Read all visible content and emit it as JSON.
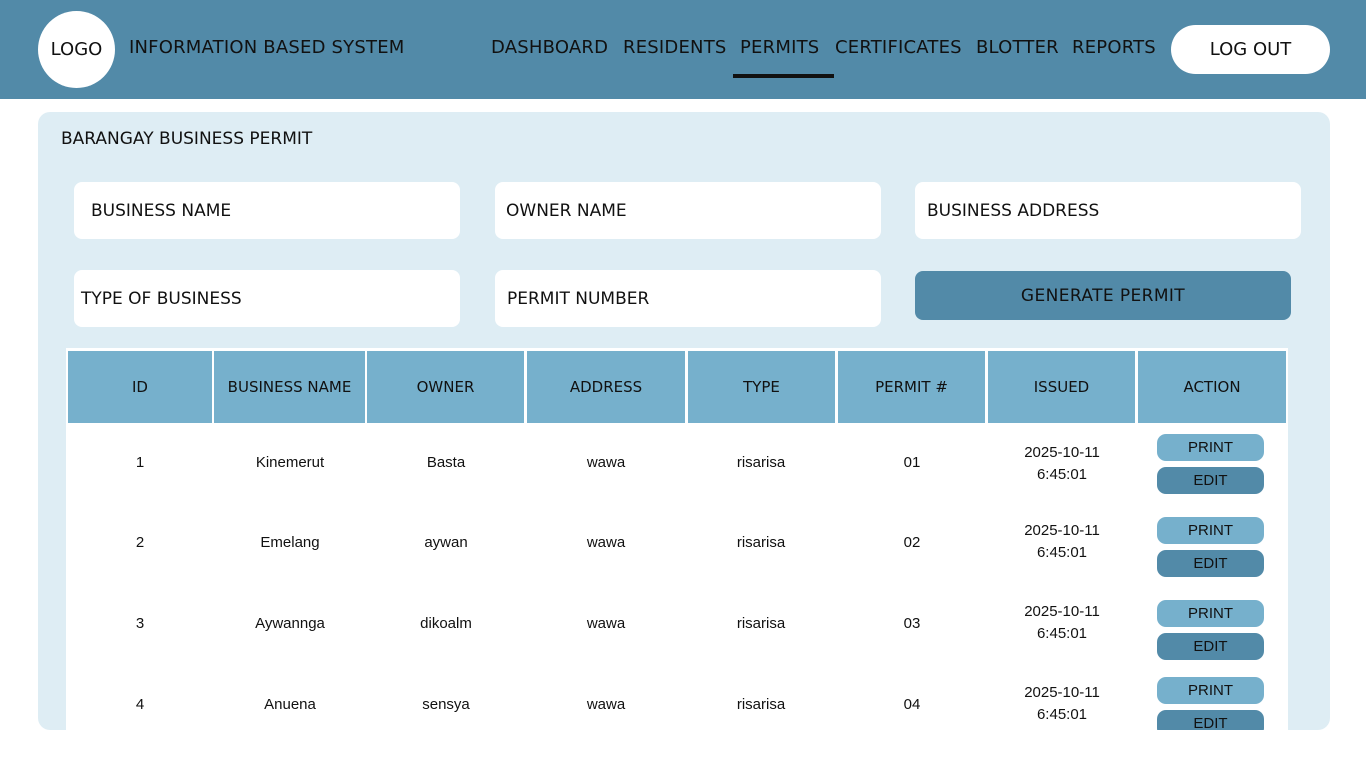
{
  "header": {
    "logo": "LOGO",
    "title": "INFORMATION BASED SYSTEM",
    "nav": [
      "DASHBOARD",
      "RESIDENTS",
      "PERMITS",
      "CERTIFICATES",
      "BLOTTER",
      "REPORTS"
    ],
    "active_nav": "PERMITS",
    "logout": "LOG OUT"
  },
  "panel": {
    "title": "BARANGAY BUSINESS PERMIT",
    "fields": {
      "business_name": "BUSINESS NAME",
      "owner_name": "OWNER NAME",
      "business_address": "BUSINESS ADDRESS",
      "type_of_business": "TYPE OF BUSINESS",
      "permit_number": "PERMIT NUMBER"
    },
    "generate_button": "GENERATE  PERMIT"
  },
  "table": {
    "columns": [
      "ID",
      "BUSINESS NAME",
      "OWNER",
      "ADDRESS",
      "TYPE",
      "PERMIT #",
      "ISSUED",
      "ACTION"
    ],
    "rows": [
      {
        "id": "1",
        "business_name": "Kinemerut",
        "owner": "Basta",
        "address": "wawa",
        "type": "risarisa",
        "permit": "01",
        "issued_date": "2025-10-11",
        "issued_time": "6:45:01"
      },
      {
        "id": "2",
        "business_name": "Emelang",
        "owner": "aywan",
        "address": "wawa",
        "type": "risarisa",
        "permit": "02",
        "issued_date": "2025-10-11",
        "issued_time": "6:45:01"
      },
      {
        "id": "3",
        "business_name": "Aywannga",
        "owner": "dikoalm",
        "address": "wawa",
        "type": "risarisa",
        "permit": "03",
        "issued_date": "2025-10-11",
        "issued_time": "6:45:01"
      },
      {
        "id": "4",
        "business_name": "Anuena",
        "owner": "sensya",
        "address": "wawa",
        "type": "risarisa",
        "permit": "04",
        "issued_date": "2025-10-11",
        "issued_time": "6:45:01"
      }
    ],
    "print_label": "PRINT",
    "edit_label": "EDIT"
  },
  "colors": {
    "header_bg": "#528aa8",
    "panel_bg": "#deedf4",
    "table_header_bg": "#76b0cc",
    "print_button": "#76b0cc",
    "edit_button": "#528aa8"
  }
}
